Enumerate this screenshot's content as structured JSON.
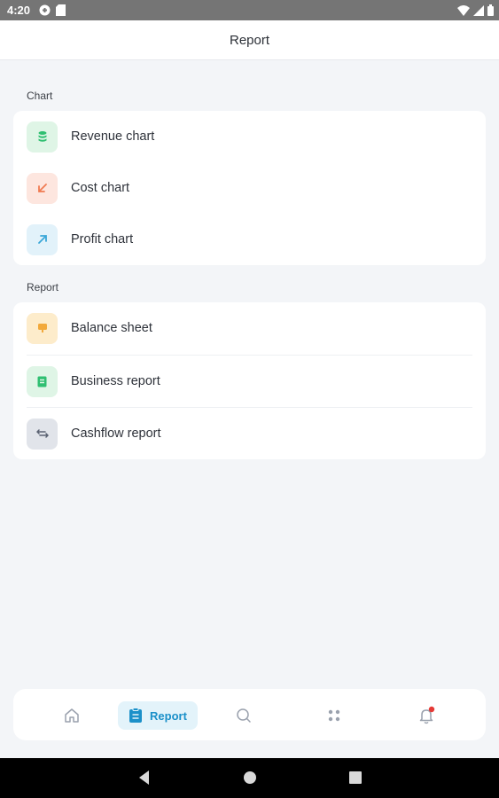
{
  "status_bar": {
    "time": "4:20"
  },
  "header": {
    "title": "Report"
  },
  "sections": {
    "chart": {
      "label": "Chart",
      "items": [
        {
          "label": "Revenue chart",
          "icon": "database-icon",
          "bg": "#dff5e6",
          "fg": "#2fbf71"
        },
        {
          "label": "Cost chart",
          "icon": "arrow-down-left-icon",
          "bg": "#fde6df",
          "fg": "#f07b52"
        },
        {
          "label": "Profit chart",
          "icon": "arrow-up-right-icon",
          "bg": "#e2f2fa",
          "fg": "#3aa7d8"
        }
      ]
    },
    "report": {
      "label": "Report",
      "items": [
        {
          "label": "Balance sheet",
          "icon": "balance-icon",
          "bg": "#fdeccb",
          "fg": "#f2a93b"
        },
        {
          "label": "Business report",
          "icon": "document-icon",
          "bg": "#dff5e6",
          "fg": "#2fbf71"
        },
        {
          "label": "Cashflow report",
          "icon": "transfer-icon",
          "bg": "#e1e4ea",
          "fg": "#5a6272"
        }
      ]
    }
  },
  "bottom_nav": {
    "active_label": "Report",
    "active_color": "#1b90c9",
    "items": [
      "home-icon",
      "report-icon",
      "search-icon",
      "apps-icon",
      "bell-icon"
    ],
    "notification_color": "#e53935"
  }
}
